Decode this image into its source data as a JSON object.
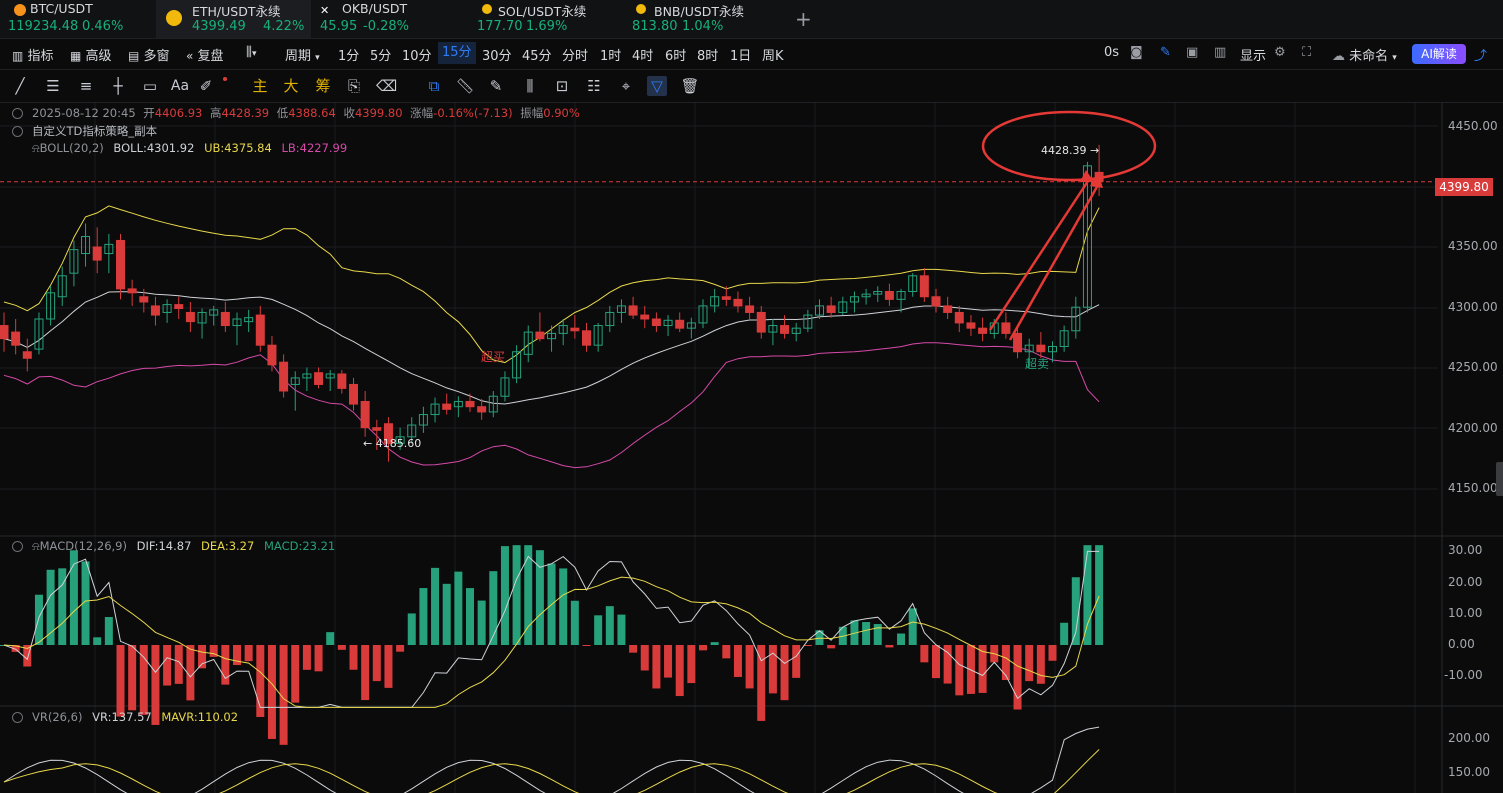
{
  "tabs": [
    {
      "name": "BTC/USDT",
      "value": "119234.48",
      "change": "0.46%",
      "icon_color": "#f7931a"
    },
    {
      "name": "ETH/USDT永续",
      "value": "4399.49",
      "change": "4.22%",
      "icon_color": "#f0b90b"
    },
    {
      "name": "OKB/USDT",
      "value": "45.95",
      "change": "-0.28%",
      "icon_color": "#ffffff"
    },
    {
      "name": "SOL/USDT永续",
      "value": "177.70",
      "change": "1.69%",
      "icon_color": "#f0b90b"
    },
    {
      "name": "BNB/USDT永续",
      "value": "813.80",
      "change": "1.04%",
      "icon_color": "#f0b90b"
    }
  ],
  "toolbar": {
    "indicator": "指标",
    "advanced": "高级",
    "multi_window": "多窗",
    "replay": "复盘",
    "period": "周期",
    "intervals": [
      "1分",
      "5分",
      "10分",
      "15分",
      "30分",
      "45分",
      "分时",
      "1时",
      "4时",
      "6时",
      "8时",
      "1日",
      "周K"
    ],
    "selected_interval": "15分",
    "countdown": "0s",
    "display": "显示",
    "unnamed": "未命名",
    "ai": "AI解读"
  },
  "drawing_tools": {
    "main": "主",
    "big": "大",
    "chip": "筹",
    "text": "Aa"
  },
  "ohlc": {
    "datetime": "2025-08-12 20:45",
    "open_label": "开",
    "open": "4406.93",
    "high_label": "高",
    "high": "4428.39",
    "low_label": "低",
    "low": "4388.64",
    "close_label": "收",
    "close": "4399.80",
    "change_label": "涨幅",
    "change": "-0.16%(-7.13)",
    "amplitude_label": "振幅",
    "amplitude": "0.90%"
  },
  "strategy": "自定义TD指标策略_副本",
  "boll": {
    "name": "BOLL(20,2)",
    "boll": "BOLL:4301.92",
    "ub": "UB:4375.84",
    "lb": "LB:4227.99"
  },
  "macd": {
    "name": "MACD(12,26,9)",
    "dif": "DIF:14.87",
    "dea": "DEA:3.27",
    "macd": "MACD:23.21"
  },
  "vr": {
    "name": "VR(26,6)",
    "vr": "VR:137.57",
    "mavr": "MAVR:110.02"
  },
  "annotations": {
    "high_marker": "4428.39 →",
    "low_marker": "← 4185.60",
    "overbought": "超买",
    "oversold": "超卖"
  },
  "current_price": "4399.80",
  "price_axis": [
    "4450.00",
    "4350.00",
    "4300.00",
    "4250.00",
    "4200.00",
    "4150.00"
  ],
  "macd_axis": [
    "30.00",
    "20.00",
    "10.00",
    "0.00",
    "-10.00"
  ],
  "vr_axis": [
    "200.00",
    "150.00"
  ],
  "colors": {
    "up": "#26a17b",
    "down": "#d93a3a",
    "boll_mid": "#cfd2d6",
    "boll_ub": "#e8d84a",
    "boll_lb": "#d64aa8",
    "accent": "#2d7df6"
  },
  "chart_data": {
    "type": "candlestick",
    "interval": "15分",
    "candles_ohlc": [
      [
        4290,
        4300,
        4270,
        4280
      ],
      [
        4285,
        4295,
        4268,
        4275
      ],
      [
        4270,
        4280,
        4255,
        4265
      ],
      [
        4272,
        4300,
        4268,
        4295
      ],
      [
        4295,
        4320,
        4290,
        4315
      ],
      [
        4312,
        4335,
        4305,
        4328
      ],
      [
        4330,
        4355,
        4320,
        4348
      ],
      [
        4345,
        4368,
        4335,
        4358
      ],
      [
        4350,
        4365,
        4330,
        4340
      ],
      [
        4345,
        4360,
        4330,
        4352
      ],
      [
        4355,
        4360,
        4310,
        4318
      ],
      [
        4318,
        4325,
        4305,
        4315
      ],
      [
        4312,
        4318,
        4300,
        4308
      ],
      [
        4305,
        4312,
        4290,
        4298
      ],
      [
        4300,
        4310,
        4292,
        4306
      ],
      [
        4306,
        4312,
        4295,
        4303
      ],
      [
        4300,
        4308,
        4285,
        4293
      ],
      [
        4292,
        4303,
        4280,
        4300
      ],
      [
        4298,
        4305,
        4290,
        4302
      ],
      [
        4300,
        4308,
        4285,
        4290
      ],
      [
        4290,
        4300,
        4275,
        4295
      ],
      [
        4293,
        4302,
        4285,
        4296
      ],
      [
        4298,
        4305,
        4270,
        4275
      ],
      [
        4275,
        4282,
        4255,
        4260
      ],
      [
        4262,
        4268,
        4235,
        4240
      ],
      [
        4245,
        4255,
        4225,
        4250
      ],
      [
        4250,
        4258,
        4240,
        4253
      ],
      [
        4254,
        4258,
        4242,
        4245
      ],
      [
        4250,
        4256,
        4240,
        4253
      ],
      [
        4253,
        4256,
        4238,
        4242
      ],
      [
        4245,
        4250,
        4225,
        4230
      ],
      [
        4232,
        4240,
        4205,
        4212
      ],
      [
        4212,
        4218,
        4195,
        4210
      ],
      [
        4215,
        4220,
        4186,
        4200
      ],
      [
        4200,
        4212,
        4195,
        4205
      ],
      [
        4205,
        4220,
        4200,
        4214
      ],
      [
        4214,
        4228,
        4208,
        4222
      ],
      [
        4222,
        4235,
        4216,
        4230
      ],
      [
        4230,
        4238,
        4222,
        4226
      ],
      [
        4228,
        4236,
        4220,
        4232
      ],
      [
        4232,
        4238,
        4224,
        4228
      ],
      [
        4228,
        4234,
        4218,
        4224
      ],
      [
        4224,
        4240,
        4220,
        4236
      ],
      [
        4236,
        4255,
        4232,
        4250
      ],
      [
        4250,
        4275,
        4246,
        4270
      ],
      [
        4268,
        4290,
        4262,
        4285
      ],
      [
        4285,
        4300,
        4278,
        4280
      ],
      [
        4280,
        4290,
        4270,
        4284
      ],
      [
        4284,
        4295,
        4275,
        4290
      ],
      [
        4288,
        4298,
        4280,
        4286
      ],
      [
        4286,
        4292,
        4270,
        4275
      ],
      [
        4275,
        4292,
        4270,
        4290
      ],
      [
        4290,
        4305,
        4285,
        4300
      ],
      [
        4300,
        4310,
        4292,
        4305
      ],
      [
        4305,
        4312,
        4295,
        4298
      ],
      [
        4298,
        4305,
        4288,
        4295
      ],
      [
        4295,
        4300,
        4285,
        4290
      ],
      [
        4290,
        4298,
        4282,
        4294
      ],
      [
        4294,
        4300,
        4285,
        4288
      ],
      [
        4288,
        4296,
        4280,
        4292
      ],
      [
        4292,
        4310,
        4288,
        4305
      ],
      [
        4305,
        4318,
        4300,
        4312
      ],
      [
        4312,
        4320,
        4305,
        4310
      ],
      [
        4310,
        4316,
        4300,
        4305
      ],
      [
        4305,
        4312,
        4295,
        4300
      ],
      [
        4300,
        4305,
        4280,
        4285
      ],
      [
        4285,
        4295,
        4275,
        4290
      ],
      [
        4290,
        4298,
        4280,
        4284
      ],
      [
        4284,
        4292,
        4278,
        4288
      ],
      [
        4288,
        4302,
        4285,
        4298
      ],
      [
        4298,
        4310,
        4295,
        4305
      ],
      [
        4305,
        4312,
        4296,
        4300
      ],
      [
        4300,
        4312,
        4298,
        4308
      ],
      [
        4308,
        4316,
        4300,
        4312
      ],
      [
        4312,
        4318,
        4306,
        4314
      ],
      [
        4314,
        4320,
        4308,
        4316
      ],
      [
        4316,
        4322,
        4305,
        4310
      ],
      [
        4310,
        4318,
        4300,
        4316
      ],
      [
        4316,
        4330,
        4312,
        4328
      ],
      [
        4328,
        4334,
        4308,
        4312
      ],
      [
        4312,
        4318,
        4300,
        4305
      ],
      [
        4305,
        4312,
        4295,
        4300
      ],
      [
        4300,
        4305,
        4285,
        4292
      ],
      [
        4292,
        4298,
        4282,
        4288
      ],
      [
        4288,
        4296,
        4278,
        4284
      ],
      [
        4284,
        4295,
        4280,
        4292
      ],
      [
        4292,
        4300,
        4280,
        4284
      ],
      [
        4284,
        4290,
        4265,
        4270
      ],
      [
        4270,
        4280,
        4258,
        4275
      ],
      [
        4275,
        4285,
        4265,
        4270
      ],
      [
        4270,
        4278,
        4262,
        4274
      ],
      [
        4274,
        4290,
        4270,
        4286
      ],
      [
        4286,
        4312,
        4280,
        4304
      ],
      [
        4304,
        4415,
        4300,
        4412
      ],
      [
        4407,
        4428,
        4389,
        4400
      ]
    ],
    "xlabel": "",
    "ylabel": "",
    "ylim": [
      4130,
      4460
    ],
    "price_low_marker": 4185.6,
    "price_high_marker": 4428.39
  }
}
